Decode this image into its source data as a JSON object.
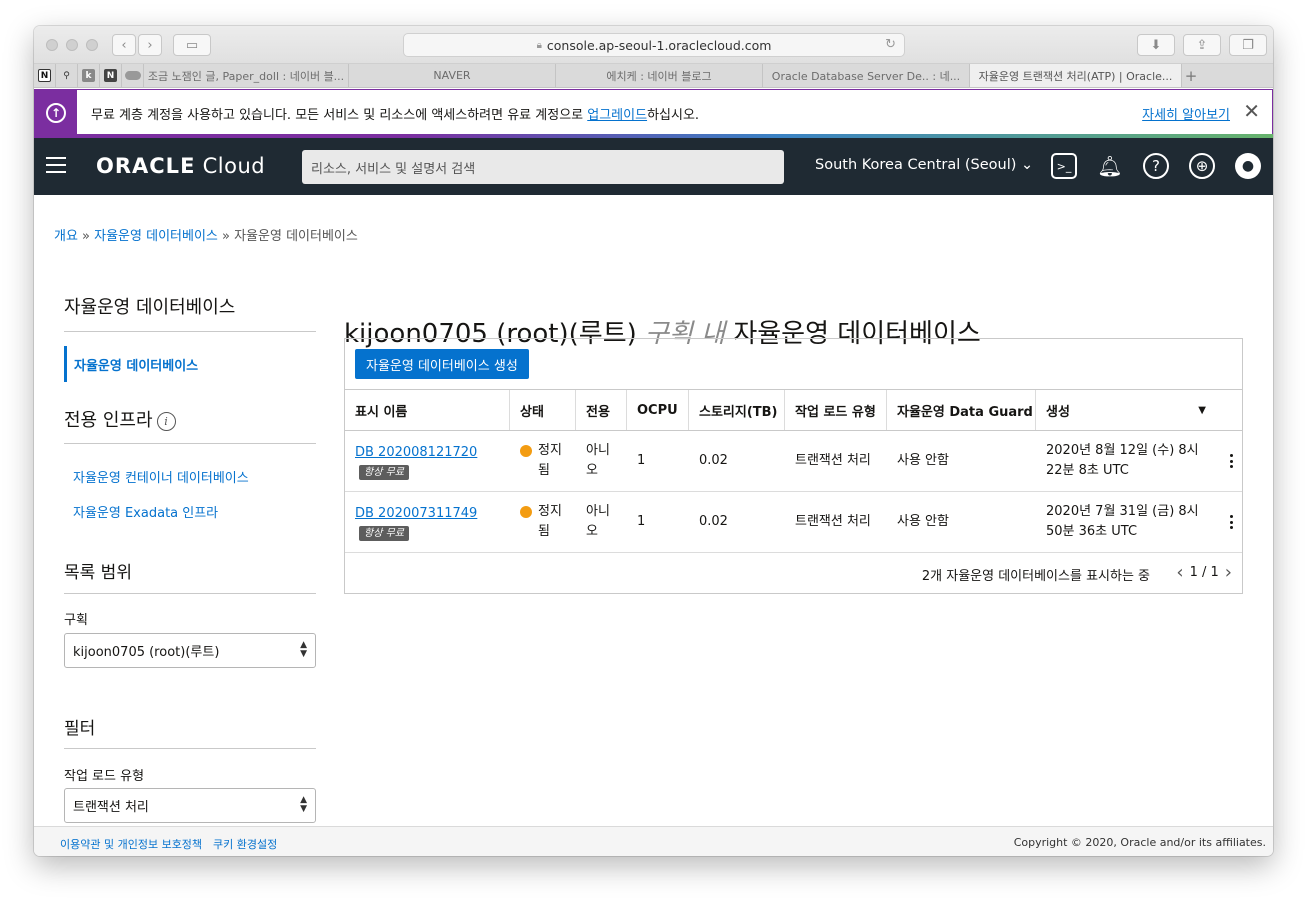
{
  "browser": {
    "url": "console.ap-seoul-1.oraclecloud.com",
    "pinned_tabs": [
      {
        "icon": "notion-icon",
        "glyph": "N"
      },
      {
        "icon": "person-icon",
        "glyph": "⚲"
      },
      {
        "icon": "k-icon",
        "glyph": "k"
      },
      {
        "icon": "naver-n-icon",
        "glyph": "N"
      },
      {
        "icon": "pill-icon",
        "glyph": "—"
      }
    ],
    "tabs": [
      {
        "label": "조금 노잼인 글, Paper_doll : 네이버 블...",
        "active": false
      },
      {
        "label": "NAVER",
        "active": false
      },
      {
        "label": "에치케 : 네이버 블로그",
        "active": false
      },
      {
        "label": "Oracle Database Server De.. : 네...",
        "active": false
      },
      {
        "label": "자율운영 트랜잭션 처리(ATP) | Oracle...",
        "active": true
      }
    ]
  },
  "banner": {
    "text_before": "무료 계층 계정을 사용하고 있습니다. 모든 서비스 및 리소스에 액세스하려면 유료 계정으로 ",
    "upgrade_link": "업그레이드",
    "text_after": "하십시오.",
    "learn_more": "자세히 알아보기",
    "accent_color": "#7b2ea0"
  },
  "header": {
    "logo_bold": "ORACLE",
    "logo_light": " Cloud",
    "search_placeholder": "리소스, 서비스 및 설명서 검색",
    "region": "South Korea Central (Seoul)"
  },
  "breadcrumb": {
    "items": [
      "개요",
      "자율운영 데이터베이스",
      "자율운영 데이터베이스"
    ],
    "separator": " » "
  },
  "sidebar": {
    "section_title": "자율운영 데이터베이스",
    "active_item": "자율운영 데이터베이스",
    "infra_title": "전용 인프라",
    "infra_links": [
      "자율운영 컨테이너 데이터베이스",
      "자율운영 Exadata 인프라"
    ],
    "scope_title": "목록 범위",
    "compartment_label": "구획",
    "compartment_value": "kijoon0705 (root)(루트)",
    "filter_title": "필터",
    "workload_label": "작업 로드 유형",
    "workload_value": "트랜잭션 처리"
  },
  "main": {
    "title_prefix": "kijoon0705 (root)(루트)",
    "title_em": " 구획 내",
    "title_suffix": " 자율운영 데이터베이스",
    "create_button": "자율운영 데이터베이스 생성",
    "columns": [
      "표시 이름",
      "상태",
      "전용",
      "OCPU",
      "스토리지(TB)",
      "작업 로드 유형",
      "자율운영 Data Guard",
      "생성"
    ],
    "rows": [
      {
        "name": "DB 202008121720",
        "tag": "항상 무료",
        "status": "정지됨",
        "dedicated": "아니오",
        "ocpu": "1",
        "storage": "0.02",
        "workload": "트랜잭션 처리",
        "dataguard": "사용 안함",
        "created": "2020년 8월 12일 (수) 8시 22분 8초 UTC"
      },
      {
        "name": "DB 202007311749",
        "tag": "항상 무료",
        "status": "정지됨",
        "dedicated": "아니오",
        "ocpu": "1",
        "storage": "0.02",
        "workload": "트랜잭션 처리",
        "dataguard": "사용 안함",
        "created": "2020년 7월 31일 (금) 8시 50분 36초 UTC"
      }
    ],
    "footer_count": "2개 자율운영 데이터베이스를 표시하는 중",
    "pager": "1 / 1",
    "status_color": "#f39c12"
  },
  "footer": {
    "terms": "이용약관 및 개인정보 보호정책",
    "cookies": "쿠키 환경설정",
    "copyright": "Copyright © 2020, Oracle and/or its affiliates."
  }
}
